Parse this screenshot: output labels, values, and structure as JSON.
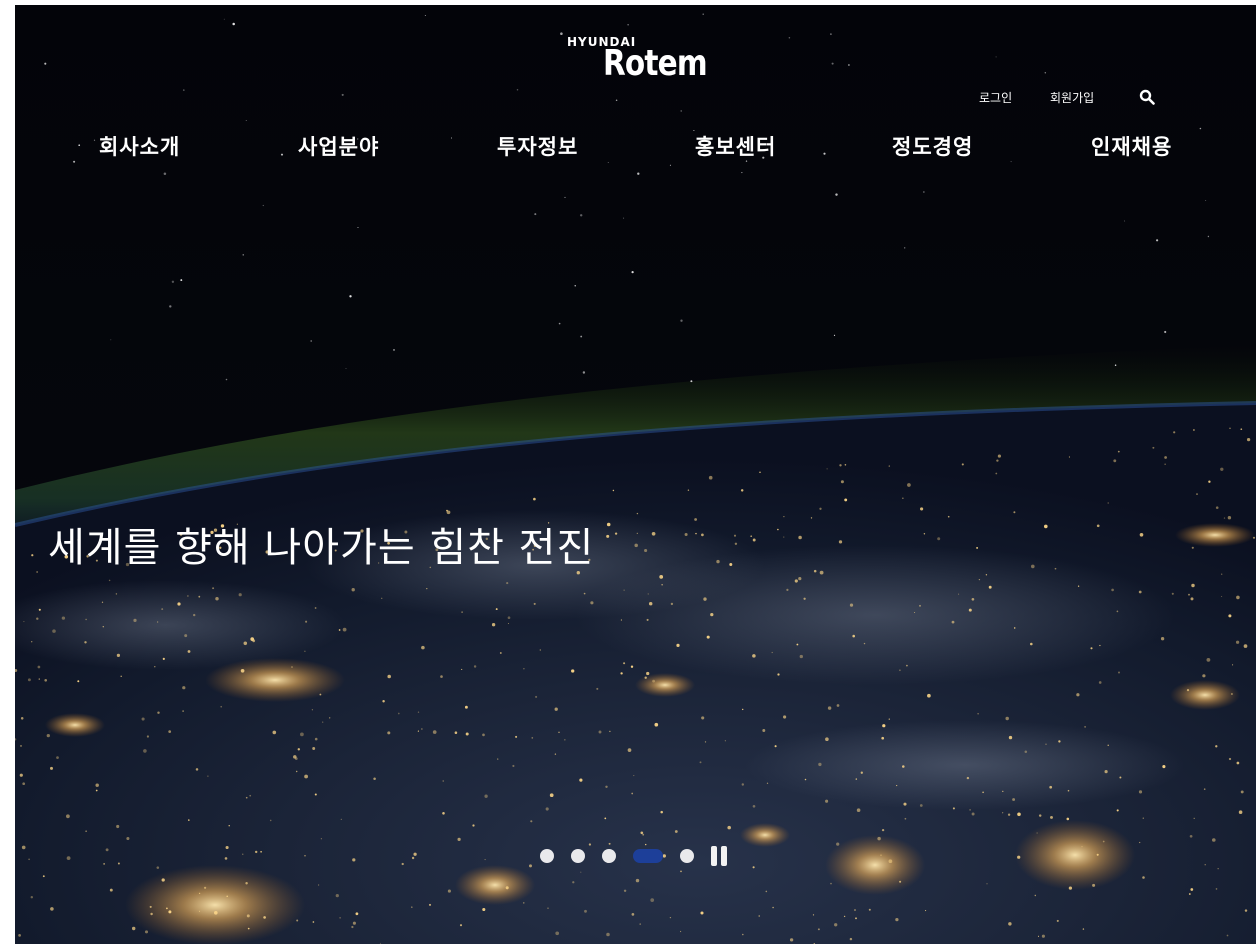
{
  "header": {
    "logo": {
      "brand_small": "HYUNDAI",
      "brand_large": "Rotem"
    },
    "util_links": {
      "login": "로그인",
      "signup": "회원가입",
      "search_icon": "search-icon"
    },
    "nav": [
      {
        "label": "회사소개"
      },
      {
        "label": "사업분야"
      },
      {
        "label": "투자정보"
      },
      {
        "label": "홍보센터"
      },
      {
        "label": "정도경영"
      },
      {
        "label": "인재채용"
      }
    ]
  },
  "hero": {
    "headline": "세계를 향해 나아가는 힘찬 전진",
    "slider": {
      "slide_count": 5,
      "active_index": 3,
      "pause_icon": "pause-icon"
    }
  },
  "colors": {
    "background": "#05070c",
    "text": "#ffffff",
    "active_dot": "#1d3f99",
    "inactive_dot": "#e9e9ec"
  }
}
